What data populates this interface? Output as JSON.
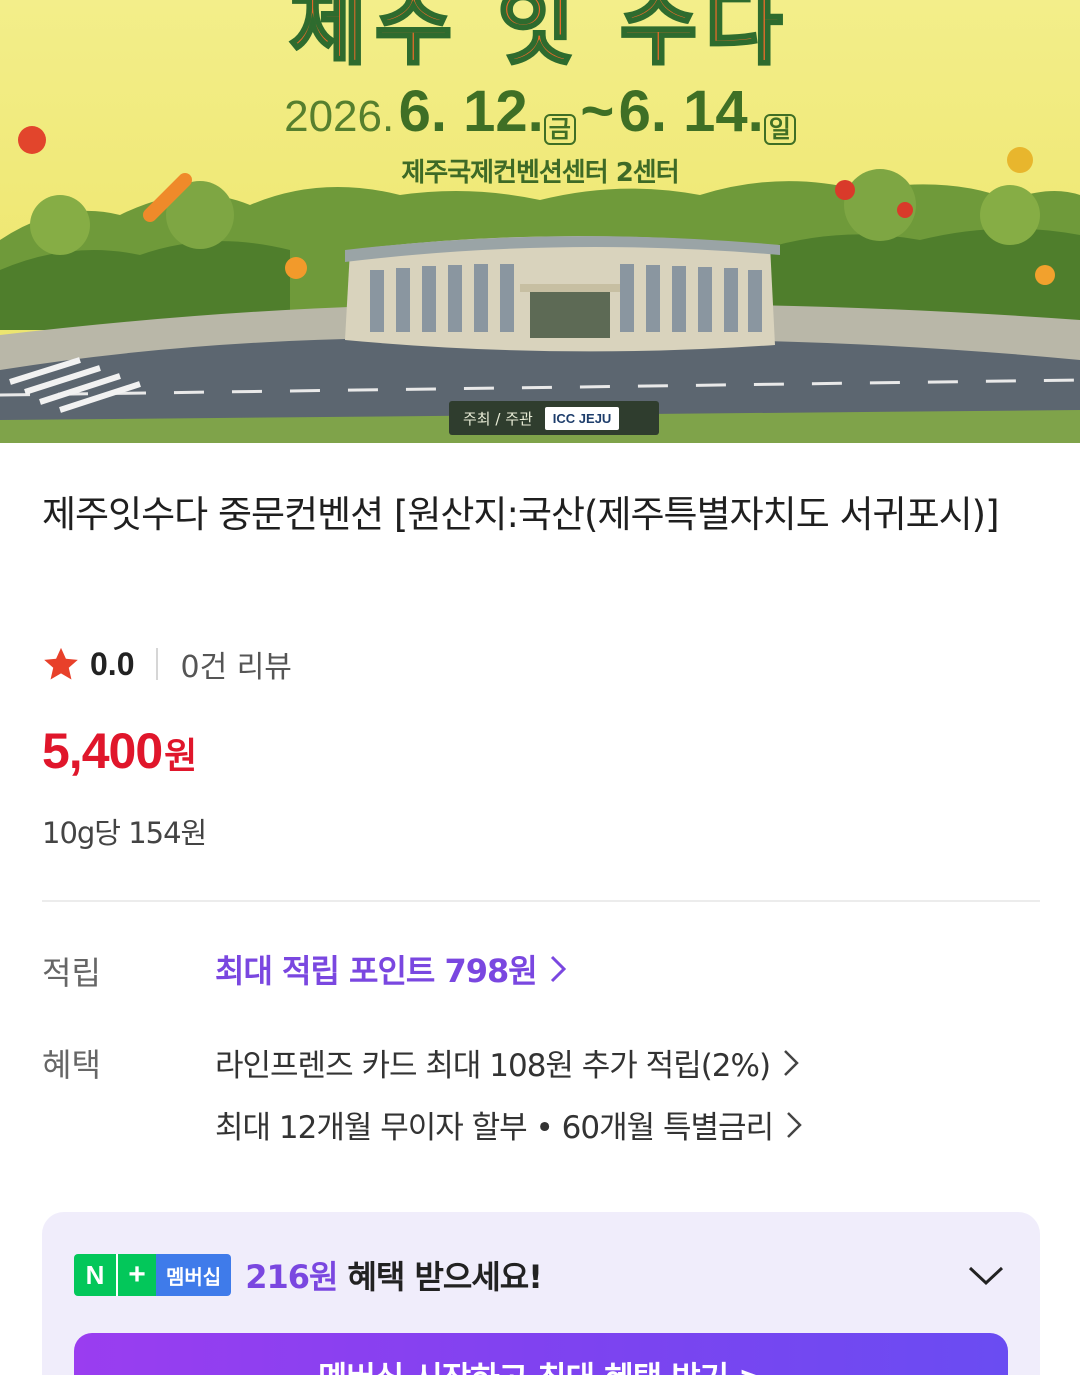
{
  "banner": {
    "title": "제주 잇 수다",
    "date_year": "2026.",
    "date_start": "6. 12.",
    "date_start_dow": "금",
    "date_sep": "~",
    "date_end": "6. 14.",
    "date_end_dow": "일",
    "venue": "제주국제컨벤션센터 2센터",
    "host_label": "주최 / 주관",
    "host_logo": "ICC JEJU"
  },
  "product": {
    "title": "제주잇수다 중문컨벤션 [원산지:국산(제주특별자치도 서귀포시)]",
    "rating_score": "0.0",
    "review_count": "0건 리뷰",
    "price_amount": "5,400",
    "price_unit": "원",
    "unit_price": "10g당 154원"
  },
  "details": {
    "points_label": "적립",
    "points_value": "최대 적립 포인트 798원",
    "benefits_label": "혜택",
    "benefit_1": "라인프렌즈 카드 최대 108원 추가 적립(2%)",
    "benefit_2": "최대 12개월 무이자 할부 • 60개월 특별금리"
  },
  "membership": {
    "badge_n": "N",
    "badge_plus": "+",
    "badge_label": "멤버십",
    "amount": "216원",
    "text": "혜택 받으세요!",
    "cta": "멤버십 시작하고 최대 혜택 받기 >"
  },
  "colors": {
    "price_red": "#e0162b",
    "accent_purple": "#7a47e0",
    "naver_green": "#03c75a",
    "star": "#e8402a"
  }
}
